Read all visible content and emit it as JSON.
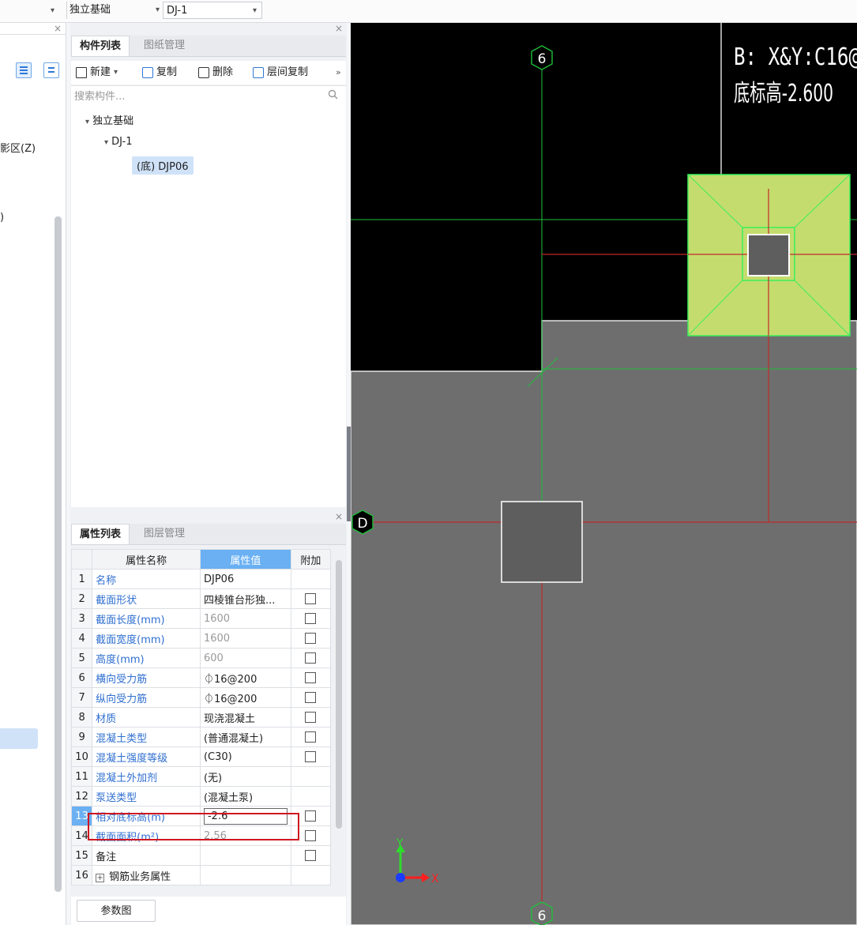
{
  "topbar": {
    "select1_caret": "▾",
    "select2": "独立基础",
    "select3": "DJ-1",
    "caret": "▾"
  },
  "left_panel": {
    "close": "×",
    "text_zone": "影区(Z)",
    "text_paren": ")"
  },
  "component_panel": {
    "tabs": [
      "构件列表",
      "图纸管理"
    ],
    "close": "×",
    "toolbar": {
      "new": "新建",
      "new_caret": "▾",
      "copy": "复制",
      "delete": "删除",
      "floor_copy": "层间复制",
      "more": "»"
    },
    "search_placeholder": "搜索构件...",
    "tree": {
      "root": "独立基础",
      "child": "DJ-1",
      "leaf": "(底) DJP06"
    }
  },
  "property_panel": {
    "tabs": [
      "属性列表",
      "图层管理"
    ],
    "close": "×",
    "columns": [
      "属性名称",
      "属性值",
      "附加"
    ],
    "rows": [
      {
        "num": "1",
        "name": "名称",
        "value": "DJP06",
        "checkbox": false,
        "gray": false
      },
      {
        "num": "2",
        "name": "截面形状",
        "value": "四棱锥台形独...",
        "checkbox": true,
        "gray": false
      },
      {
        "num": "3",
        "name": "截面长度(mm)",
        "value": "1600",
        "checkbox": true,
        "gray": true
      },
      {
        "num": "4",
        "name": "截面宽度(mm)",
        "value": "1600",
        "checkbox": true,
        "gray": true
      },
      {
        "num": "5",
        "name": "高度(mm)",
        "value": "600",
        "checkbox": true,
        "gray": true
      },
      {
        "num": "6",
        "name": "横向受力筋",
        "value": "⏀16@200",
        "checkbox": true,
        "gray": false
      },
      {
        "num": "7",
        "name": "纵向受力筋",
        "value": "⏀16@200",
        "checkbox": true,
        "gray": false
      },
      {
        "num": "8",
        "name": "材质",
        "value": "现浇混凝土",
        "checkbox": true,
        "gray": false
      },
      {
        "num": "9",
        "name": "混凝土类型",
        "value": "(普通混凝土)",
        "checkbox": true,
        "gray": false
      },
      {
        "num": "10",
        "name": "混凝土强度等级",
        "value": "(C30)",
        "checkbox": true,
        "gray": false
      },
      {
        "num": "11",
        "name": "混凝土外加剂",
        "value": "(无)",
        "checkbox": false,
        "gray": false
      },
      {
        "num": "12",
        "name": "泵送类型",
        "value": "(混凝土泵)",
        "checkbox": false,
        "gray": false
      },
      {
        "num": "13",
        "name": "相对底标高(m)",
        "value": "-2.6",
        "checkbox": true,
        "gray": false,
        "editing": true
      },
      {
        "num": "14",
        "name": "截面面积(m²)",
        "value": "2.56",
        "checkbox": true,
        "gray": true
      },
      {
        "num": "15",
        "name": "备注",
        "value": "",
        "checkbox": true,
        "gray": false,
        "black": true
      }
    ],
    "group_row": {
      "num": "16",
      "plus": "+",
      "name": "钢筋业务属性"
    },
    "param_button": "参数图"
  },
  "canvas": {
    "label_line1": "B: X&Y:C16@",
    "label_line2": "底标高-2.600",
    "axis_top": "6",
    "axis_bottom": "6",
    "axis_left": "D",
    "coord_x": "X",
    "coord_y": "Y",
    "colors": {
      "grid_green": "#1fbf3a",
      "grid_red": "#c0282a",
      "footing_fill": "#c4dc6e",
      "footing_line": "#3bef5c",
      "floor_gray": "#6e6e6e"
    }
  }
}
